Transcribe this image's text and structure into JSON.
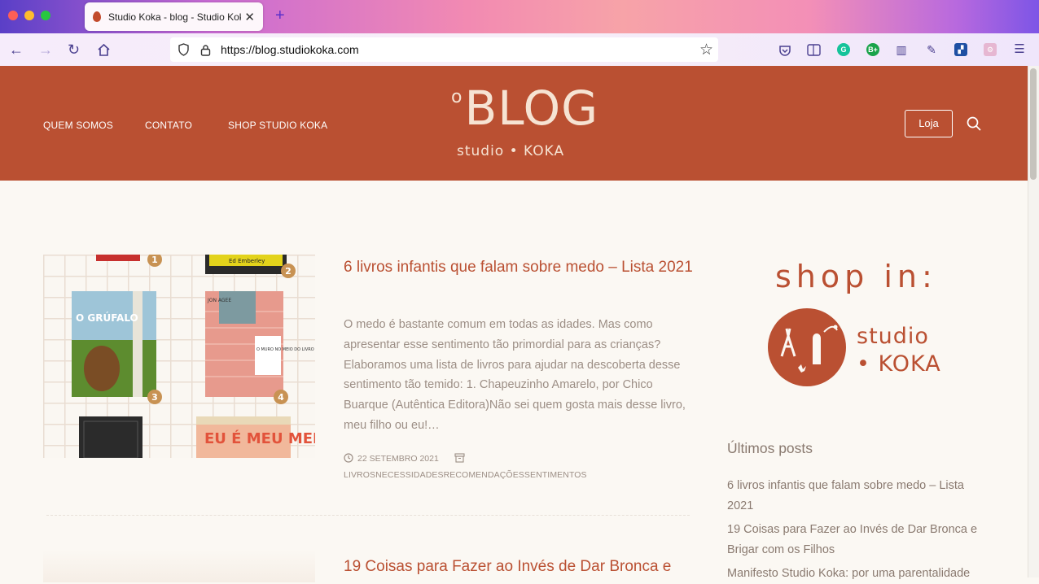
{
  "browser": {
    "tab_title": "Studio Koka - blog - Studio Koka",
    "url": "https://blog.studiokoka.com"
  },
  "site": {
    "nav": [
      "QUEM SOMOS",
      "CONTATO",
      "SHOP STUDIO KOKA"
    ],
    "logo_top": "BLOG",
    "logo_mark": "o",
    "logo_bottom": "studio • KOKA",
    "loja_button": "Loja"
  },
  "post1": {
    "title": "6 livros infantis que falam sobre medo – Lista 2021",
    "excerpt": "O medo é bastante comum em todas as idades. Mas como apresentar esse sentimento tão primordial para as crianças? Elaboramos uma lista de livros para ajudar na descoberta desse sentimento tão temido: 1. Chapeuzinho Amarelo, por Chico Buarque (Autêntica Editora)Não sei quem gosta mais desse livro, meu filho ou eu!…",
    "date": "22 SETEMBRO 2021",
    "categories": "LIVROSNECESSIDADESRECOMENDAÇÕESSENTIMENTOS",
    "image_numbers": [
      "1",
      "2",
      "3",
      "4"
    ],
    "image_texts": {
      "book_gruffalo": "O GRÚFALO",
      "book_muro": "O MURO NO MEIO DO LIVRO",
      "book_muro_author": "JON AGEE",
      "book_ed": "Ed Emberley",
      "book_medo": "EU É MEU MEDO"
    }
  },
  "post2": {
    "title": "19 Coisas para Fazer ao Invés de Dar Bronca e"
  },
  "sidebar": {
    "shop_in": "shop in:",
    "studio_line1": "studio",
    "studio_line2": "• KOKA",
    "latest_heading": "Últimos posts",
    "latest_posts": [
      "6 livros infantis que falam sobre medo – Lista 2021",
      "19 Coisas para Fazer ao Invés de Dar Bronca e Brigar com os Filhos",
      "Manifesto Studio Koka: por uma parentalidade"
    ]
  },
  "colors": {
    "brand": "#ba5032",
    "text_muted": "#9c8e85",
    "background": "#fbf8f3"
  }
}
